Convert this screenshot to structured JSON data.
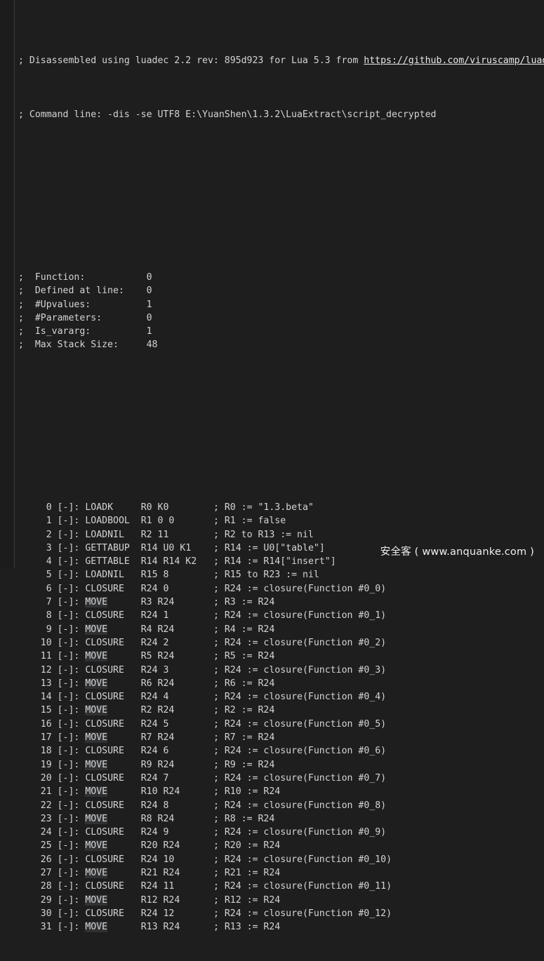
{
  "background_color": "#1e1e1e",
  "gutter_color": "#1c1c1c",
  "text_color": "#d4d4d4",
  "header": {
    "line1_prefix": "; Disassembled using luadec 2.2 rev: 895d923 for Lua 5.3 from ",
    "line1_url": "https://github.com/viruscamp/luadec",
    "line2": "; Command line: -dis -se UTF8 E:\\YuanShen\\1.3.2\\LuaExtract\\script_decrypted"
  },
  "function_meta": [
    {
      "label": "; Function:",
      "value": "0"
    },
    {
      "label": "; Defined at line:",
      "value": "0"
    },
    {
      "label": "; #Upvalues:",
      "value": "1"
    },
    {
      "label": "; #Parameters:",
      "value": "0"
    },
    {
      "label": "; Is_vararg:",
      "value": "1"
    },
    {
      "label": "; Max Stack Size:",
      "value": "48"
    }
  ],
  "function_meta_lines": [
    ";  Function:           0",
    ";  Defined at line:    0",
    ";  #Upvalues:          1",
    ";  #Parameters:        0",
    ";  Is_vararg:          1",
    ";  Max Stack Size:     48"
  ],
  "instructions": [
    {
      "index": "0",
      "flag": "[-]:",
      "op": "LOADK",
      "args": "R0 K0",
      "comment": "; R0 := \"1.3.beta\""
    },
    {
      "index": "1",
      "flag": "[-]:",
      "op": "LOADBOOL",
      "args": "R1 0 0",
      "comment": "; R1 := false"
    },
    {
      "index": "2",
      "flag": "[-]:",
      "op": "LOADNIL",
      "args": "R2 11",
      "comment": "; R2 to R13 := nil"
    },
    {
      "index": "3",
      "flag": "[-]:",
      "op": "GETTABUP",
      "args": "R14 U0 K1",
      "comment": "; R14 := U0[\"table\"]"
    },
    {
      "index": "4",
      "flag": "[-]:",
      "op": "GETTABLE",
      "args": "R14 R14 K2",
      "comment": "; R14 := R14[\"insert\"]"
    },
    {
      "index": "5",
      "flag": "[-]:",
      "op": "LOADNIL",
      "args": "R15 8",
      "comment": "; R15 to R23 := nil"
    },
    {
      "index": "6",
      "flag": "[-]:",
      "op": "CLOSURE",
      "args": "R24 0",
      "comment": "; R24 := closure(Function #0_0)"
    },
    {
      "index": "7",
      "flag": "[-]:",
      "op": "MOVE",
      "args": "R3 R24",
      "comment": "; R3 := R24"
    },
    {
      "index": "8",
      "flag": "[-]:",
      "op": "CLOSURE",
      "args": "R24 1",
      "comment": "; R24 := closure(Function #0_1)"
    },
    {
      "index": "9",
      "flag": "[-]:",
      "op": "MOVE",
      "args": "R4 R24",
      "comment": "; R4 := R24"
    },
    {
      "index": "10",
      "flag": "[-]:",
      "op": "CLOSURE",
      "args": "R24 2",
      "comment": "; R24 := closure(Function #0_2)"
    },
    {
      "index": "11",
      "flag": "[-]:",
      "op": "MOVE",
      "args": "R5 R24",
      "comment": "; R5 := R24"
    },
    {
      "index": "12",
      "flag": "[-]:",
      "op": "CLOSURE",
      "args": "R24 3",
      "comment": "; R24 := closure(Function #0_3)"
    },
    {
      "index": "13",
      "flag": "[-]:",
      "op": "MOVE",
      "args": "R6 R24",
      "comment": "; R6 := R24"
    },
    {
      "index": "14",
      "flag": "[-]:",
      "op": "CLOSURE",
      "args": "R24 4",
      "comment": "; R24 := closure(Function #0_4)"
    },
    {
      "index": "15",
      "flag": "[-]:",
      "op": "MOVE",
      "args": "R2 R24",
      "comment": "; R2 := R24"
    },
    {
      "index": "16",
      "flag": "[-]:",
      "op": "CLOSURE",
      "args": "R24 5",
      "comment": "; R24 := closure(Function #0_5)"
    },
    {
      "index": "17",
      "flag": "[-]:",
      "op": "MOVE",
      "args": "R7 R24",
      "comment": "; R7 := R24"
    },
    {
      "index": "18",
      "flag": "[-]:",
      "op": "CLOSURE",
      "args": "R24 6",
      "comment": "; R24 := closure(Function #0_6)"
    },
    {
      "index": "19",
      "flag": "[-]:",
      "op": "MOVE",
      "args": "R9 R24",
      "comment": "; R9 := R24"
    },
    {
      "index": "20",
      "flag": "[-]:",
      "op": "CLOSURE",
      "args": "R24 7",
      "comment": "; R24 := closure(Function #0_7)"
    },
    {
      "index": "21",
      "flag": "[-]:",
      "op": "MOVE",
      "args": "R10 R24",
      "comment": "; R10 := R24"
    },
    {
      "index": "22",
      "flag": "[-]:",
      "op": "CLOSURE",
      "args": "R24 8",
      "comment": "; R24 := closure(Function #0_8)"
    },
    {
      "index": "23",
      "flag": "[-]:",
      "op": "MOVE",
      "args": "R8 R24",
      "comment": "; R8 := R24"
    },
    {
      "index": "24",
      "flag": "[-]:",
      "op": "CLOSURE",
      "args": "R24 9",
      "comment": "; R24 := closure(Function #0_9)"
    },
    {
      "index": "25",
      "flag": "[-]:",
      "op": "MOVE",
      "args": "R20 R24",
      "comment": "; R20 := R24"
    },
    {
      "index": "26",
      "flag": "[-]:",
      "op": "CLOSURE",
      "args": "R24 10",
      "comment": "; R24 := closure(Function #0_10)"
    },
    {
      "index": "27",
      "flag": "[-]:",
      "op": "MOVE",
      "args": "R21 R24",
      "comment": "; R21 := R24"
    },
    {
      "index": "28",
      "flag": "[-]:",
      "op": "CLOSURE",
      "args": "R24 11",
      "comment": "; R24 := closure(Function #0_11)"
    },
    {
      "index": "29",
      "flag": "[-]:",
      "op": "MOVE",
      "args": "R12 R24",
      "comment": "; R12 := R24"
    },
    {
      "index": "30",
      "flag": "[-]:",
      "op": "CLOSURE",
      "args": "R24 12",
      "comment": "; R24 := closure(Function #0_12)"
    },
    {
      "index": "31",
      "flag": "[-]:",
      "op": "MOVE",
      "args": "R13 R24",
      "comment": "; R13 := R24"
    }
  ],
  "watermark": "安全客 ( www.anquanke.com )"
}
